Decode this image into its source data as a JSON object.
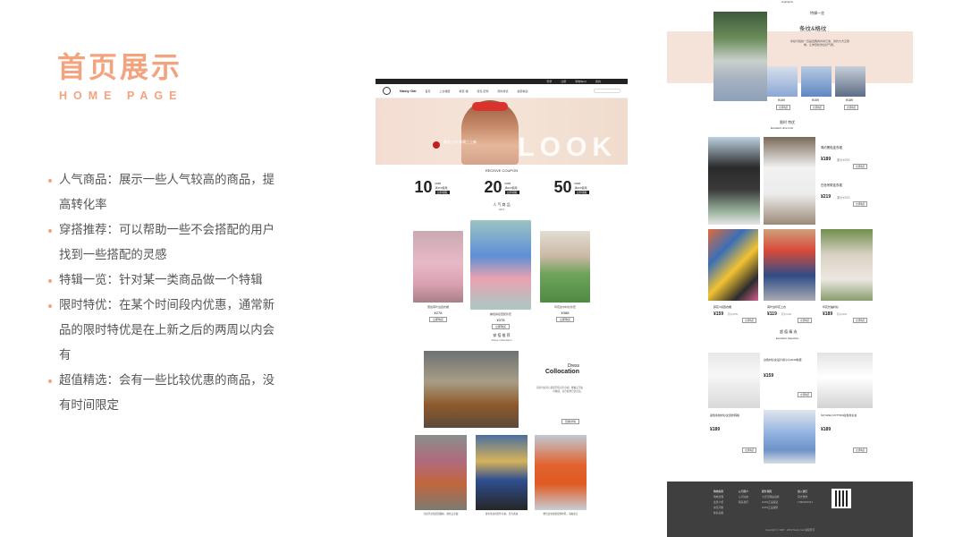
{
  "heading": {
    "title": "首页展示",
    "subtitle": "HOME PAGE"
  },
  "bullets": [
    "人气商品：展示一些人气较高的商品，提高转化率",
    "穿搭推荐：可以帮助一些不会搭配的用户找到一些搭配的灵感",
    "特辑一览：针对某一类商品做一个特辑",
    "限时特优：在某个时间段内优惠，通常新品的限时特优是在上新之后的两周以内会有",
    "超值精选：会有一些比较优惠的商品，没有时间限定"
  ],
  "mockA": {
    "topbar": [
      "登录",
      "注册",
      "购物车(0)",
      "我的"
    ],
    "logo": "Nasty Gal",
    "nav": [
      "首页",
      "上衣裙装",
      "裤装·裙",
      "鞋包·配饰",
      "限时特优",
      "超值精选"
    ],
    "hero": {
      "word": "LOOK",
      "slogan": "新品上市 每周三上新"
    },
    "coupon_title": "RECEIVE COUPON",
    "coupons": [
      {
        "num": "10",
        "unit": "RMB",
        "desc": "满150使用",
        "btn": "立即领取"
      },
      {
        "num": "20",
        "unit": "RMB",
        "desc": "满200使用",
        "btn": "立即领取"
      },
      {
        "num": "50",
        "unit": "RMB",
        "desc": "满400使用",
        "btn": "立即领取"
      }
    ],
    "hot_title": "人 气 商 品",
    "hot_sub": "HOT",
    "hot_items": [
      {
        "cap": "蕾丝荷叶边连衣裙",
        "price": "¥278",
        "btn": "立即购买"
      },
      {
        "cap": "撞色拼接西装外套",
        "price": "¥378",
        "btn": "立即购买"
      },
      {
        "cap": "印花丝巾衬衫外套",
        "price": "¥388",
        "btn": "立即购买"
      }
    ],
    "dress_title": "穿 搭 推 荐",
    "dress_sub": "Dress collocation",
    "dress_label1": "Dress",
    "dress_label2": "Collocation",
    "dress_desc": "简约针织背心搭配同色系半身裙，慵懒又不失时髦感，适合秋季日常出街。",
    "dress_more": "查看详情",
    "bottom_caps": [
      "针织开衫搭配阔腿裤，随性又显瘦",
      "拼色毛衣搭配牛仔裤，活力满满",
      "橙色连衣裙搭配帆布鞋，清爽夏日"
    ]
  },
  "mockB": {
    "highlights": "Highlights",
    "special_title": "特辑一览",
    "stripe_title": "条纹&格纹",
    "stripe_desc": "条纹与格纹一直是经典的时尚元素，简约大方又耐看，让你轻松穿出好气质。",
    "stripe_prices": [
      "¥169",
      "¥159",
      "¥189"
    ],
    "stripe_btn": "立即购买",
    "timed_title": "限时 特优",
    "timed_sub": "Excellent time limit",
    "timed_items": [
      {
        "name": "简约黑色连衣裙",
        "price": "¥189",
        "old": "原价¥299",
        "btn": "立即购买"
      },
      {
        "name": "白色吊带连衣裙",
        "price": "¥219",
        "old": "原价¥329",
        "btn": "立即购买"
      }
    ],
    "floral_items": [
      {
        "name": "碎花V领连衣裙",
        "price": "¥159",
        "old": "原价¥259",
        "btn": "立即购买"
      },
      {
        "name": "荷叶边印花上衣",
        "price": "¥119",
        "old": "原价¥199",
        "btn": "立即购买"
      },
      {
        "name": "印花长袖衬衫",
        "price": "¥189",
        "old": "原价¥269",
        "btn": "立即购买"
      }
    ],
    "sel_title": "超 值 精 选",
    "sel_sub": "Excellent Selection",
    "sel_items": [
      {
        "name": "白色衬衫女设计感小众2019秋装",
        "price": "¥159",
        "btn": "立即购买"
      },
      {
        "name": "蓝色条纹衬衫女宽松韩版",
        "price": "¥189",
        "btn": "立即购买"
      },
      {
        "name": "SUYANA COTTON白色衬衫女",
        "price": "¥189",
        "btn": "立即购买"
      }
    ],
    "footer_cols": [
      [
        "购物指南",
        "购物流程",
        "会员介绍",
        "常见问题",
        "联系客服"
      ],
      [
        "公司简介",
        "公司动态",
        "联系我们"
      ],
      [
        "服务保障",
        "七天无理由退换",
        "100%正品保证",
        "100%正品保障"
      ],
      [
        "加入我们",
        "官方微博",
        "17800000711"
      ]
    ],
    "copyright": "Copyright © 1997 - 2019 Nasty Gal 版权所有"
  },
  "colors": {
    "accent": "#f4a37f",
    "pink_band": "#f5e3d9",
    "footer": "#3f3f3f"
  }
}
